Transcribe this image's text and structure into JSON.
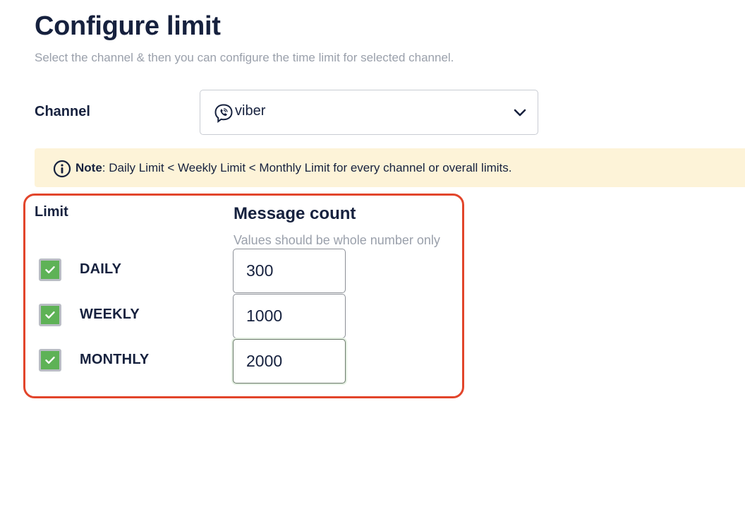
{
  "header": {
    "title": "Configure limit",
    "subtitle": "Select the channel & then you can configure the time limit for selected channel."
  },
  "channel": {
    "label": "Channel",
    "selected": "viber",
    "icon": "viber-icon"
  },
  "note": {
    "icon": "info-icon",
    "bold": "Note",
    "text": ": Daily Limit < Weekly Limit < Monthly Limit for every channel or overall limits."
  },
  "limits": {
    "highlight_color": "#e2452b",
    "column_limit": "Limit",
    "column_count": "Message count",
    "count_hint": "Values should be whole number only",
    "rows": [
      {
        "label": "DAILY",
        "checked": true,
        "value": "300"
      },
      {
        "label": "WEEKLY",
        "checked": true,
        "value": "1000"
      },
      {
        "label": "MONTHLY",
        "checked": true,
        "value": "2000"
      }
    ]
  },
  "colors": {
    "checkbox_checked": "#5eb256",
    "note_background": "#fdf3d8"
  }
}
